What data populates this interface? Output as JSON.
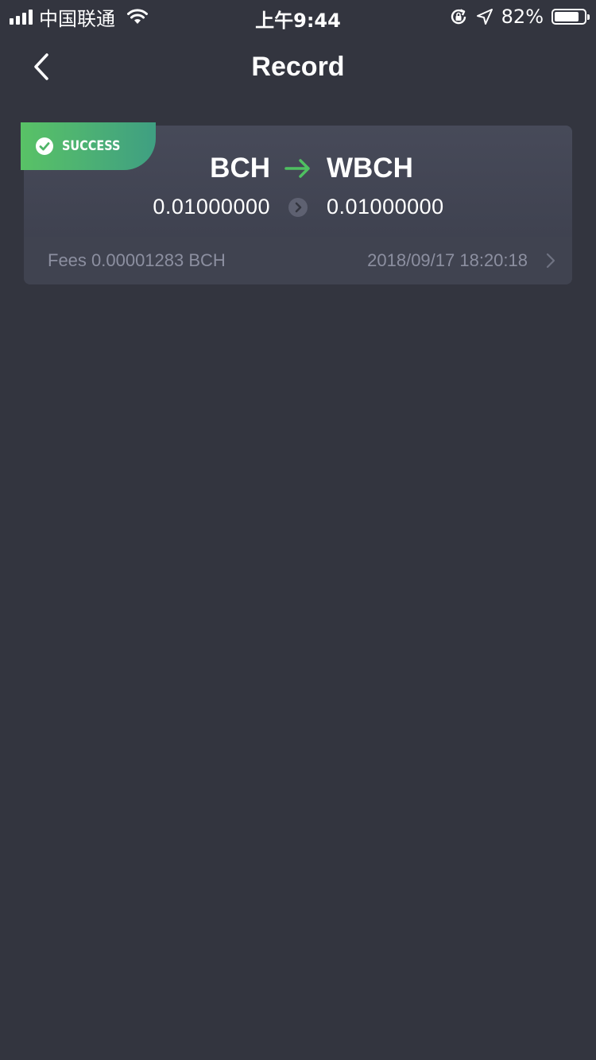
{
  "status_bar": {
    "carrier": "中国联通",
    "time": "上午9:44",
    "battery_percent": "82%",
    "battery_level": 0.82
  },
  "nav": {
    "title": "Record",
    "back_icon": "chevron-left-icon"
  },
  "record": {
    "status": "SUCCESS",
    "status_color": "#59c266",
    "from_coin": "BCH",
    "to_coin": "WBCH",
    "from_amount": "0.01000000",
    "to_amount": "0.01000000",
    "arrow_color": "#4fc061",
    "fees": "Fees 0.00001283 BCH",
    "datetime": "2018/09/17 18:20:18"
  }
}
